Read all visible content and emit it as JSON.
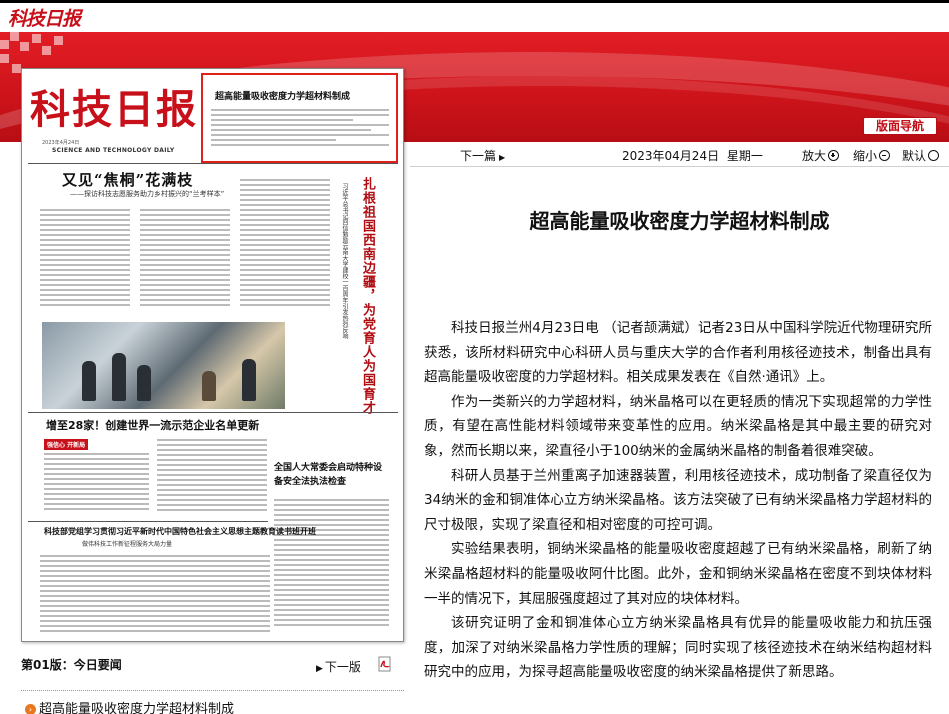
{
  "site": {
    "logo_text": "科技日报",
    "nav_button": "版面导航"
  },
  "paper": {
    "masthead": "科技日报",
    "masthead_en": "SCIENCE AND TECHNOLOGY DAILY",
    "masthead_date": "2023年4月24日",
    "highlight_title": "超高能量吸收密度力学超材料制成",
    "headline_main": "又见“焦桐”花满枝",
    "subhead_main": "——探访科技志愿服务助力乡村振兴的“兰考样本”",
    "vertical_headline": "扎根祖国西南边疆，为党育人为国育才",
    "vertical_sub": "习近平总书记回信勉励云南大学建校一百周年引发热烈反响",
    "headline_2": "增至28家！创建世界一流示范企业名单更新",
    "red_tag": "强信心 开新局",
    "headline_3": "全国人大常委会启动特种设备安全法执法检查",
    "headline_4": "科技部党组学习贯彻习近平新时代中国特色社会主义思想主题教育读书班开班",
    "sub_4": "做伟科技工作新征程服务大局力量"
  },
  "below_paper": {
    "edition_label": "第01版：今日要闻",
    "next_page": "下一版",
    "pdf_icon": "pdf-icon",
    "article_link": "超高能量吸收密度力学超材料制成"
  },
  "toolbar": {
    "next_article": "下一篇",
    "date": "2023年04月24日",
    "weekday": "星期一",
    "zoom_in": "放大",
    "zoom_out": "缩小",
    "default": "默认"
  },
  "article": {
    "title": "超高能量吸收密度力学超材料制成",
    "paragraphs": [
      "科技日报兰州4月23日电 （记者颉满斌）记者23日从中国科学院近代物理研究所获悉，该所材料研究中心科研人员与重庆大学的合作者利用核径迹技术，制备出具有超高能量吸收密度的力学超材料。相关成果发表在《自然·通讯》上。",
      "作为一类新兴的力学超材料，纳米晶格可以在更轻质的情况下实现超常的力学性质，有望在高性能材料领域带来变革性的应用。纳米梁晶格是其中最主要的研究对象，然而长期以来，梁直径小于100纳米的金属纳米晶格的制备着很难突破。",
      "科研人员基于兰州重离子加速器装置，利用核径迹技术，成功制备了梁直径仅为34纳米的金和铜准体心立方纳米梁晶格。该方法突破了已有纳米梁晶格力学超材料的尺寸极限，实现了梁直径和相对密度的可控可调。",
      "实验结果表明，铜纳米梁晶格的能量吸收密度超越了已有纳米梁晶格，刷新了纳米梁晶格超材料的能量吸收阿什比图。此外，金和铜纳米梁晶格在密度不到块体材料一半的情况下，其屈服强度超过了其对应的块体材料。",
      "该研究证明了金和铜准体心立方纳米梁晶格具有优异的能量吸收能力和抗压强度，加深了对纳米梁晶格力学性质的理解；同时实现了核径迹技术在纳米结构超材料研究中的应用，为探寻超高能量吸收密度的纳米梁晶格提供了新思路。"
    ]
  },
  "colors": {
    "banner_red": "#d5161d",
    "highlight_border": "#e0201b",
    "link_bullet": "#e8781f"
  }
}
